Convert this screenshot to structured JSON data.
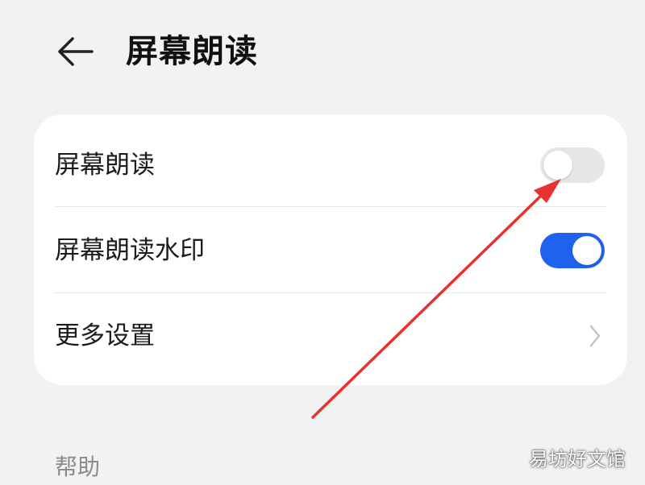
{
  "header": {
    "back_icon": "arrow-left-icon",
    "title": "屏幕朗读"
  },
  "settings": {
    "rows": [
      {
        "label": "屏幕朗读",
        "control": "toggle",
        "enabled": false
      },
      {
        "label": "屏幕朗读水印",
        "control": "toggle",
        "enabled": true
      },
      {
        "label": "更多设置",
        "control": "chevron",
        "icon": "chevron-right-icon"
      }
    ]
  },
  "help_section": {
    "label": "帮助"
  },
  "annotation": {
    "type": "red-arrow",
    "color": "#e8322e",
    "points_to": "screen-reader-toggle"
  },
  "watermark": {
    "text": "易坊好文馆"
  },
  "colors": {
    "background": "#f1f2f4",
    "card": "#ffffff",
    "toggle_on": "#1f62ef",
    "toggle_off": "#e6e6e6",
    "section_label": "#8a8a8a"
  }
}
